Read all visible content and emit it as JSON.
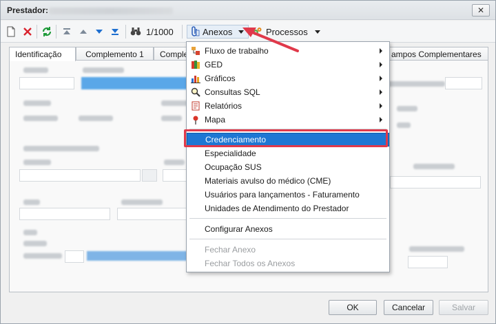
{
  "window": {
    "title": "Prestador:",
    "close_glyph": "✕"
  },
  "toolbar": {
    "record_counter": "1/1000",
    "anexos_label": "Anexos",
    "processos_label": "Processos"
  },
  "tabs": [
    {
      "label": "Identificação"
    },
    {
      "label": "Complemento 1"
    },
    {
      "label": "Comple"
    },
    {
      "label": "ampos Complementares"
    }
  ],
  "menu": {
    "submenus": [
      {
        "label": "Fluxo de trabalho",
        "icon": "workflow-icon"
      },
      {
        "label": "GED",
        "icon": "ged-icon"
      },
      {
        "label": "Gráficos",
        "icon": "chart-icon"
      },
      {
        "label": "Consultas SQL",
        "icon": "sql-search-icon"
      },
      {
        "label": "Relatórios",
        "icon": "report-icon"
      },
      {
        "label": "Mapa",
        "icon": "map-pin-icon"
      }
    ],
    "items": [
      {
        "label": "Credenciamento",
        "highlighted": true
      },
      {
        "label": "Especialidade"
      },
      {
        "label": "Ocupação SUS"
      },
      {
        "label": "Materiais avulso do médico (CME)"
      },
      {
        "label": "Usuários para lançamentos - Faturamento"
      },
      {
        "label": "Unidades de Atendimento do Prestador"
      }
    ],
    "configure": {
      "label": "Configurar Anexos"
    },
    "disabled_items": [
      {
        "label": "Fechar Anexo"
      },
      {
        "label": "Fechar Todos os Anexos"
      }
    ]
  },
  "footer": {
    "ok_label": "OK",
    "cancel_label": "Cancelar",
    "save_label": "Salvar"
  },
  "colors": {
    "menu_highlight": "#1e77d3",
    "annotation_red": "#e0394a"
  }
}
